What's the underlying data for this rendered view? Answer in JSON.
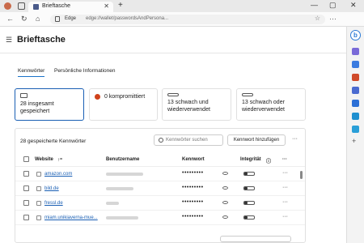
{
  "browser": {
    "tab_title": "Brieftasche",
    "new_tab": "+",
    "minimize": "—",
    "maximize": "▢",
    "close": "✕",
    "edge_label": "Edge",
    "url": "edge://wallet/passwordsAndPersona...",
    "back": "←",
    "refresh": "↻",
    "home": "⌂"
  },
  "page": {
    "title": "Brieftasche",
    "tabs": [
      "Kennwörter",
      "Persönliche Informationen"
    ]
  },
  "cards": [
    {
      "label": "28 insgesamt gespeichert"
    },
    {
      "label": "0 kompromittiert"
    },
    {
      "label": "13 schwach und wiederverwendet"
    },
    {
      "label": "13 schwach oder wiederverwendet"
    }
  ],
  "list": {
    "title": "28 gespeicherte Kennwörter",
    "search_placeholder": "Kennwörter suchen",
    "add_button": "Kennwort hinzufügen",
    "more": "···",
    "columns": {
      "website": "Website",
      "sort": "↑⁼",
      "user": "Benutzername",
      "password": "Kennwort",
      "health": "Integrität",
      "info": "ⓘ",
      "more": "···"
    },
    "rows": [
      {
        "site": "amazon.com",
        "password": "•••••••••"
      },
      {
        "site": "bild.de",
        "password": "•••••••••"
      },
      {
        "site": "fressl.de",
        "password": "•••••••••"
      },
      {
        "site": "miam.unikiaverna-mue...",
        "password": "•••••••••"
      }
    ]
  }
}
